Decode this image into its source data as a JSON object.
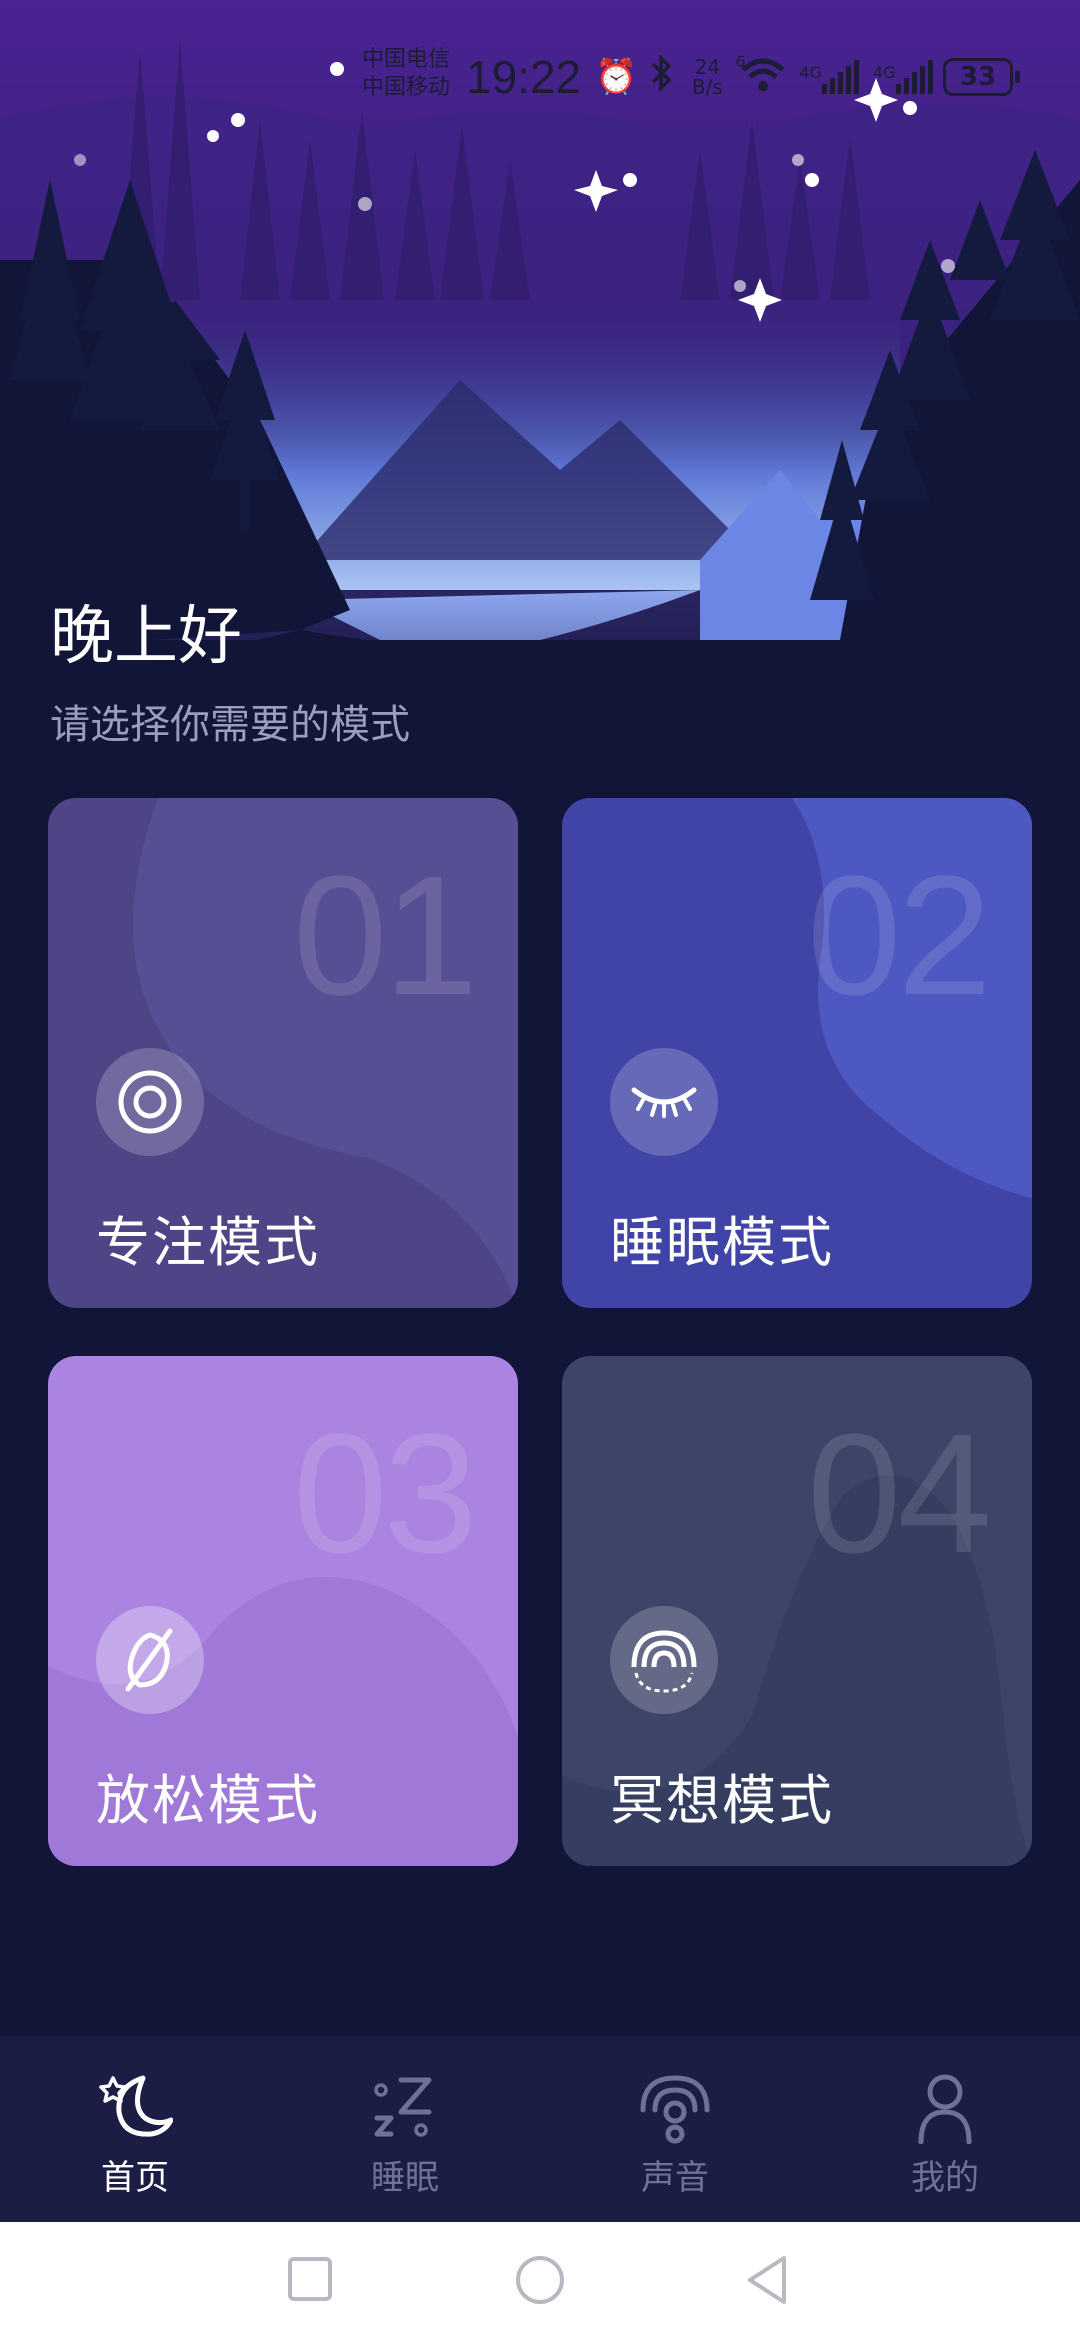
{
  "status_bar": {
    "carrier_1": "中国电信",
    "carrier_2": "中国移动",
    "time": "19:22",
    "net_speed": "24\nB/s",
    "speed_value": "24",
    "speed_unit": "B/s",
    "wifi_badge": "6",
    "sim1_type": "4G",
    "sim2_type": "4G",
    "battery": "33"
  },
  "header": {
    "greeting": "晚上好",
    "subtitle": "请选择你需要的模式"
  },
  "modes": [
    {
      "number": "01",
      "label": "专注模式",
      "icon": "focus-target-icon",
      "color": "#4e4586"
    },
    {
      "number": "02",
      "label": "睡眠模式",
      "icon": "closed-eye-icon",
      "color": "#3f44a6"
    },
    {
      "number": "03",
      "label": "放松模式",
      "icon": "leaf-icon",
      "color": "#aa84e0"
    },
    {
      "number": "04",
      "label": "冥想模式",
      "icon": "rainbow-icon",
      "color": "#3c4468"
    }
  ],
  "tabs": [
    {
      "label": "首页",
      "icon": "moon-star-icon",
      "active": true
    },
    {
      "label": "睡眠",
      "icon": "zzz-icon",
      "active": false
    },
    {
      "label": "声音",
      "icon": "podcast-icon",
      "active": false
    },
    {
      "label": "我的",
      "icon": "person-icon",
      "active": false
    }
  ]
}
